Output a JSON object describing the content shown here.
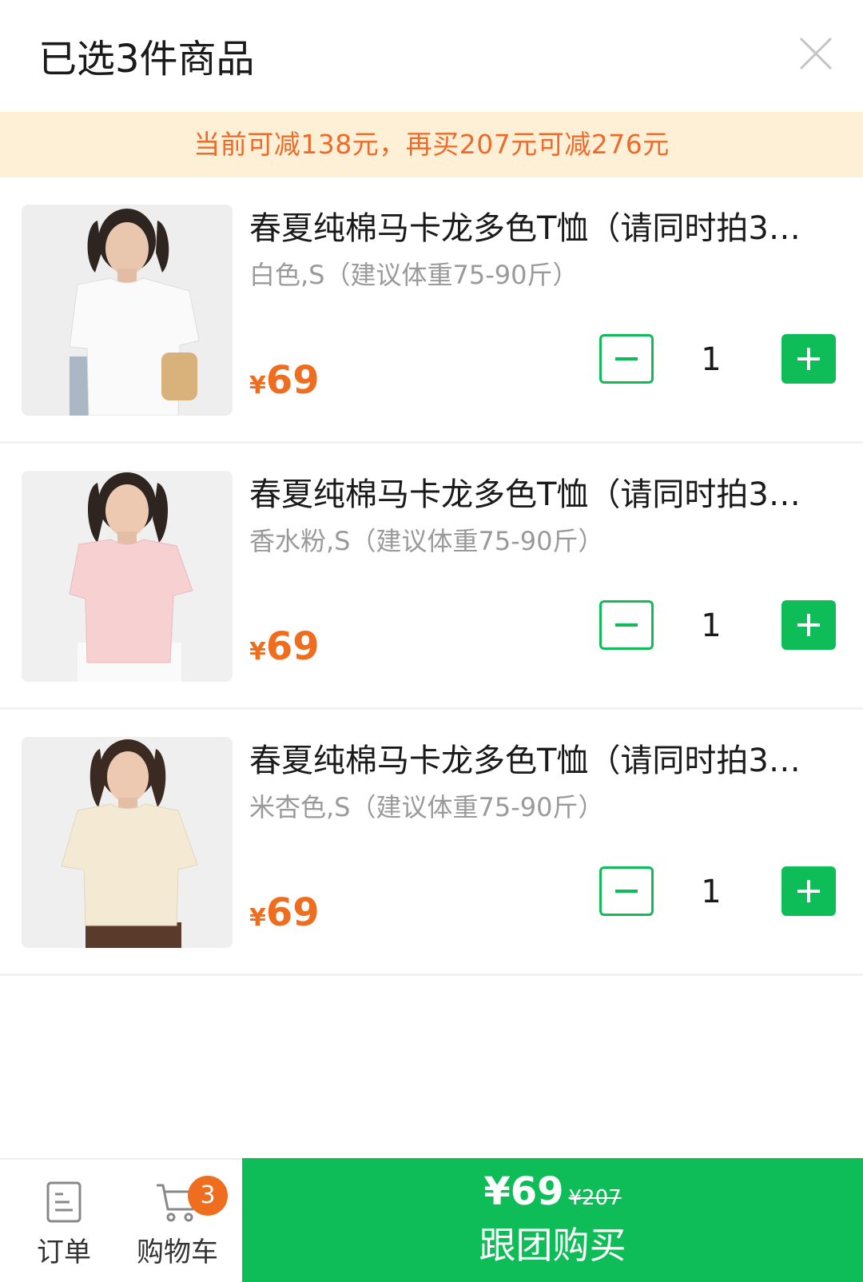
{
  "header": {
    "title": "已选3件商品",
    "close_icon": "close-icon"
  },
  "banner": {
    "text": "当前可减138元，再买207元可减276元"
  },
  "items": [
    {
      "name": "春夏纯棉马卡龙多色T恤（请同时拍3…",
      "spec": "白色,S（建议体重75-90斤）",
      "price_symbol": "¥",
      "price": "69",
      "quantity": "1",
      "shirt_color": "#fafafa"
    },
    {
      "name": "春夏纯棉马卡龙多色T恤（请同时拍3…",
      "spec": "香水粉,S（建议体重75-90斤）",
      "price_symbol": "¥",
      "price": "69",
      "quantity": "1",
      "shirt_color": "#f7d0d2"
    },
    {
      "name": "春夏纯棉马卡龙多色T恤（请同时拍3…",
      "spec": "米杏色,S（建议体重75-90斤）",
      "price_symbol": "¥",
      "price": "69",
      "quantity": "1",
      "shirt_color": "#f4ead3"
    }
  ],
  "footer": {
    "orders_label": "订单",
    "orders_icon": "document-icon",
    "cart_label": "购物车",
    "cart_icon": "cart-icon",
    "cart_badge": "3",
    "buy_price": "¥69",
    "buy_original_price": "¥207",
    "buy_label": "跟团购买"
  },
  "colors": {
    "accent_green": "#0fbd58",
    "price_orange": "#ee6d1e",
    "banner_bg": "#fdf0d6",
    "banner_text": "#ed6b2a"
  }
}
